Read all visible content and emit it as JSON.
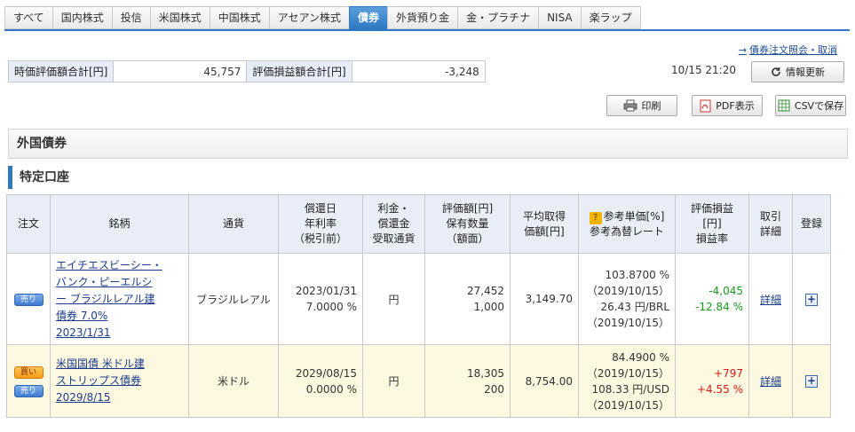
{
  "tabs": [
    {
      "label": "すべて",
      "active": false
    },
    {
      "label": "国内株式",
      "active": false
    },
    {
      "label": "投信",
      "active": false
    },
    {
      "label": "米国株式",
      "active": false
    },
    {
      "label": "中国株式",
      "active": false
    },
    {
      "label": "アセアン株式",
      "active": false
    },
    {
      "label": "債券",
      "active": true
    },
    {
      "label": "外貨預り金",
      "active": false
    },
    {
      "label": "金・プラチナ",
      "active": false
    },
    {
      "label": "NISA",
      "active": false
    },
    {
      "label": "楽ラップ",
      "active": false
    }
  ],
  "top_link": "債券注文照会・取消",
  "summary": {
    "valuation_label": "時価評価額合計[円]",
    "valuation_value": "45,757",
    "pl_label": "評価損益額合計[円]",
    "pl_value": "-3,248"
  },
  "timestamp": "10/15 21:20",
  "buttons": {
    "refresh": "情報更新",
    "print": "印刷",
    "pdf": "PDF表示",
    "csv": "CSVで保存"
  },
  "section_title": "外国債券",
  "account_title": "特定口座",
  "headers": {
    "order": "注文",
    "name": "銘柄",
    "currency": "通貨",
    "maturity": [
      "償還日",
      "年利率",
      "（税引前）"
    ],
    "payment": [
      "利金・",
      "償還金",
      "受取通貨"
    ],
    "valuation": [
      "評価額[円]",
      "保有数量",
      "（額面）"
    ],
    "avg_price": [
      "平均取得",
      "価額[円]"
    ],
    "reference": [
      "参考単価[%]",
      "参考為替レート"
    ],
    "pl": [
      "評価損益",
      "[円]",
      "損益率"
    ],
    "trade": [
      "取引",
      "詳細"
    ],
    "register": "登録"
  },
  "rows": [
    {
      "badges": [
        "売り"
      ],
      "name_lines": [
        "エイチエスビーシー・",
        "バンク・ピーエルシ",
        "ー ブラジルレアル建",
        "債券 7.0%",
        "2023/1/31"
      ],
      "currency": "ブラジルレアル",
      "maturity_date": "2023/01/31",
      "rate": "7.0000 %",
      "payment_currency": "円",
      "valuation": "27,452",
      "quantity": "1,000",
      "avg_price": "3,149.70",
      "ref_price": "103.8700 %",
      "ref_price_date": "（2019/10/15）",
      "fx_rate": "26.43 円/BRL",
      "fx_date": "（2019/10/15）",
      "pl_yen": "-4,045",
      "pl_rate": "-12.84 %",
      "pl_sign": "neg_green",
      "detail": "詳細"
    },
    {
      "badges": [
        "買い",
        "売り"
      ],
      "name_lines": [
        "米国国債 米ドル建",
        "ストリップス債券",
        "2029/8/15"
      ],
      "currency": "米ドル",
      "maturity_date": "2029/08/15",
      "rate": "0.0000 %",
      "payment_currency": "円",
      "valuation": "18,305",
      "quantity": "200",
      "avg_price": "8,754.00",
      "ref_price": "84.4900 %",
      "ref_price_date": "（2019/10/15）",
      "fx_rate": "108.33 円/USD",
      "fx_date": "（2019/10/15）",
      "pl_yen": "+797",
      "pl_rate": "+4.55 %",
      "pl_sign": "pos_red",
      "detail": "詳細"
    }
  ],
  "colors": {
    "accent": "#2f79c3",
    "gain": "#d11a1a",
    "loss": "#1a9a1a",
    "header_bg": "#e9eef6"
  },
  "icons": [
    "refresh-icon",
    "printer-icon",
    "pdf-icon",
    "csv-icon",
    "question-icon",
    "plus-icon"
  ]
}
